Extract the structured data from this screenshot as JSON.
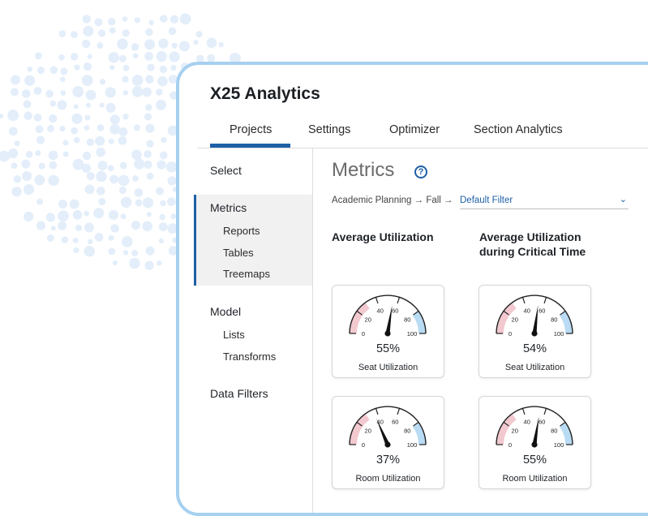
{
  "app": {
    "title": "X25 Analytics"
  },
  "tabs": [
    {
      "label": "Projects",
      "active": true
    },
    {
      "label": "Settings",
      "active": false
    },
    {
      "label": "Optimizer",
      "active": false
    },
    {
      "label": "Section Analytics",
      "active": false
    }
  ],
  "sidebar": {
    "select": "Select",
    "metrics": {
      "label": "Metrics",
      "items": [
        "Reports",
        "Tables",
        "Treemaps"
      ]
    },
    "model": {
      "label": "Model",
      "items": [
        "Lists",
        "Transforms"
      ]
    },
    "data_filters": "Data Filters"
  },
  "main": {
    "title": "Metrics",
    "help_icon": "question-circle-icon",
    "breadcrumb": "Academic Planning → Fall →",
    "filter": {
      "value": "Default Filter",
      "icon": "chevron-down-icon"
    },
    "columns": [
      {
        "heading": "Average Utilization"
      },
      {
        "heading": "Average Utilization\nduring Critical Time"
      }
    ],
    "gauges": [
      {
        "value": 55,
        "display": "55%",
        "label": "Seat Utilization"
      },
      {
        "value": 54,
        "display": "54%",
        "label": "Seat Utilization"
      },
      {
        "value": 37,
        "display": "37%",
        "label": "Room Utilization"
      },
      {
        "value": 55,
        "display": "55%",
        "label": "Room Utilization"
      }
    ],
    "gauge_ticks": [
      "0",
      "20",
      "40",
      "60",
      "80",
      "100"
    ]
  },
  "colors": {
    "accent": "#1e5fa6",
    "card_border": "#a6d0f0",
    "gauge_low": "#f2c9cf",
    "gauge_high": "#b9dbf3",
    "dots": "#e3eefa"
  }
}
